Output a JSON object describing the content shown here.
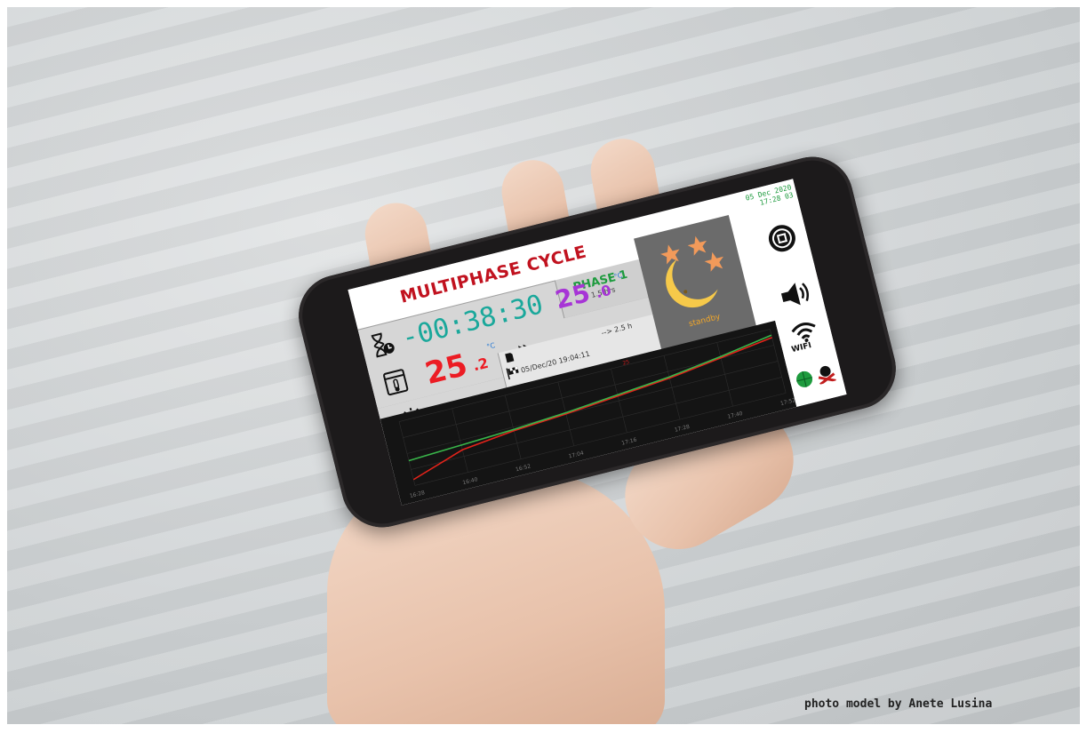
{
  "app": {
    "title": "MULTIPHASE CYCLE",
    "phase_label": "PHASE 1",
    "phase_duration": "1.5 hrs",
    "countdown": "-00:38:30",
    "current_temp": {
      "int": "25",
      "dec": ".2",
      "unit": "°C"
    },
    "target_temp": {
      "int": "25",
      "dec": ".0",
      "unit": "°C"
    },
    "ambient_temp": "20.4 °C",
    "end_time": "05/Dec/20 19:04:11",
    "remaining": "--> 2.5 h",
    "status": "standby",
    "date": {
      "line1": "05 Dec 2020",
      "line2": "17:28   03"
    }
  },
  "side_controls": {
    "stop_button": "stop-button",
    "sound_button": "speaker-icon",
    "wifi_label": "WIFI"
  },
  "chart_data": {
    "type": "line",
    "x": [
      "16:28",
      "16:40",
      "16:52",
      "17:04",
      "17:16",
      "17:28",
      "17:40",
      "17:52"
    ],
    "series": [
      {
        "color": "#e2231a",
        "values": [
          21.0,
          22.4,
          22.9,
          23.2,
          23.6,
          24.0,
          24.6,
          25.2
        ]
      },
      {
        "color": "#39b54a",
        "values": [
          22.6,
          22.8,
          23.0,
          23.3,
          23.7,
          24.1,
          24.7,
          25.4
        ]
      }
    ]
  },
  "colors": {
    "title": "#c1121f",
    "countdown": "#1aa89b",
    "current_temp": "#ec1c24",
    "target_temp": "#a735d6",
    "ambient": "#2a2ae6",
    "phase": "#1e9b3e",
    "standby_text": "#f0a62a"
  },
  "caption": "photo model by Anete Lusina"
}
